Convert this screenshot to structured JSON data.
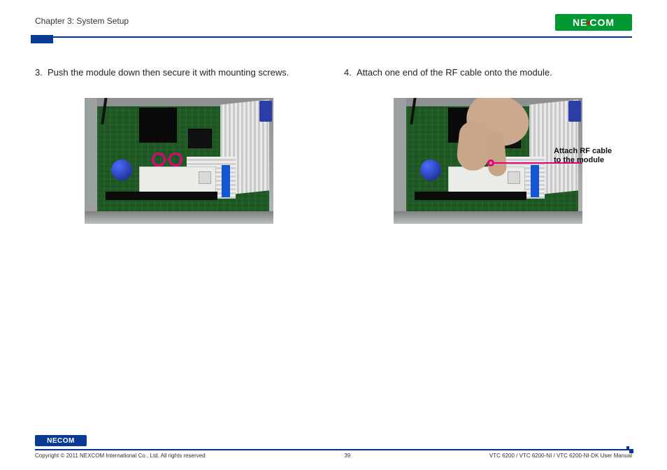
{
  "header": {
    "chapter": "Chapter 3: System Setup",
    "brand_text": "NEXCOM"
  },
  "steps": {
    "left": {
      "number": "3.",
      "text": "Push the module down then secure it with mounting screws."
    },
    "right": {
      "number": "4.",
      "text": "Attach one end of the RF cable onto the module."
    }
  },
  "callout": {
    "line1": "Attach RF cable",
    "line2": "to the module"
  },
  "footer": {
    "brand_text": "NEXCOM",
    "copyright": "Copyright © 2011 NEXCOM International Co., Ltd. All rights reserved",
    "page_number": "39",
    "doc_title": "VTC 6200 / VTC 6200-NI / VTC 6200-NI-DK User Manual"
  }
}
